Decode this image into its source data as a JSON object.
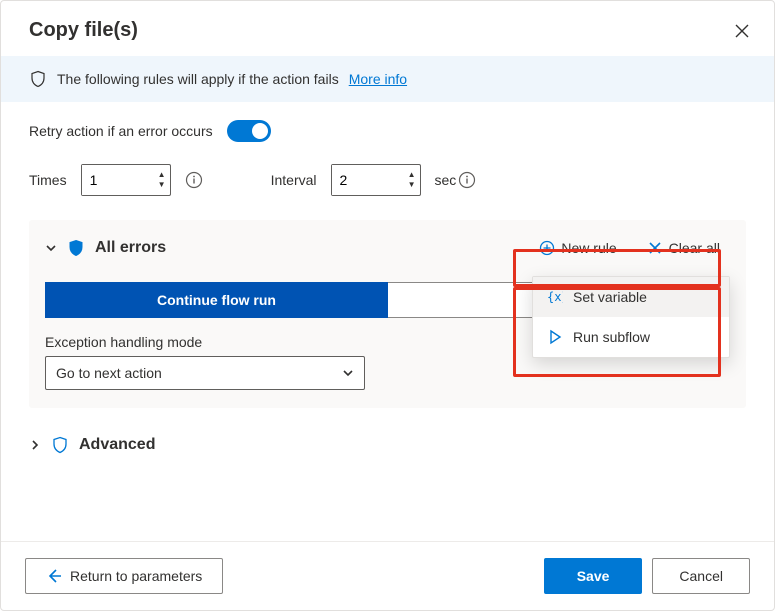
{
  "header": {
    "title": "Copy file(s)"
  },
  "info": {
    "text": "The following rules will apply if the action fails",
    "link": "More info"
  },
  "retry": {
    "label": "Retry action if an error occurs",
    "on": true,
    "times_label": "Times",
    "times_value": "1",
    "interval_label": "Interval",
    "interval_value": "2",
    "seconds_label": "sec"
  },
  "errors_panel": {
    "title": "All errors",
    "new_rule": "New rule",
    "clear_all": "Clear all",
    "tabs": {
      "continue": "Continue flow run",
      "other": ""
    },
    "exception_label": "Exception handling mode",
    "exception_value": "Go to next action",
    "menu": {
      "set_variable": "Set variable",
      "run_subflow": "Run subflow"
    }
  },
  "advanced": {
    "title": "Advanced"
  },
  "footer": {
    "return": "Return to parameters",
    "save": "Save",
    "cancel": "Cancel"
  }
}
